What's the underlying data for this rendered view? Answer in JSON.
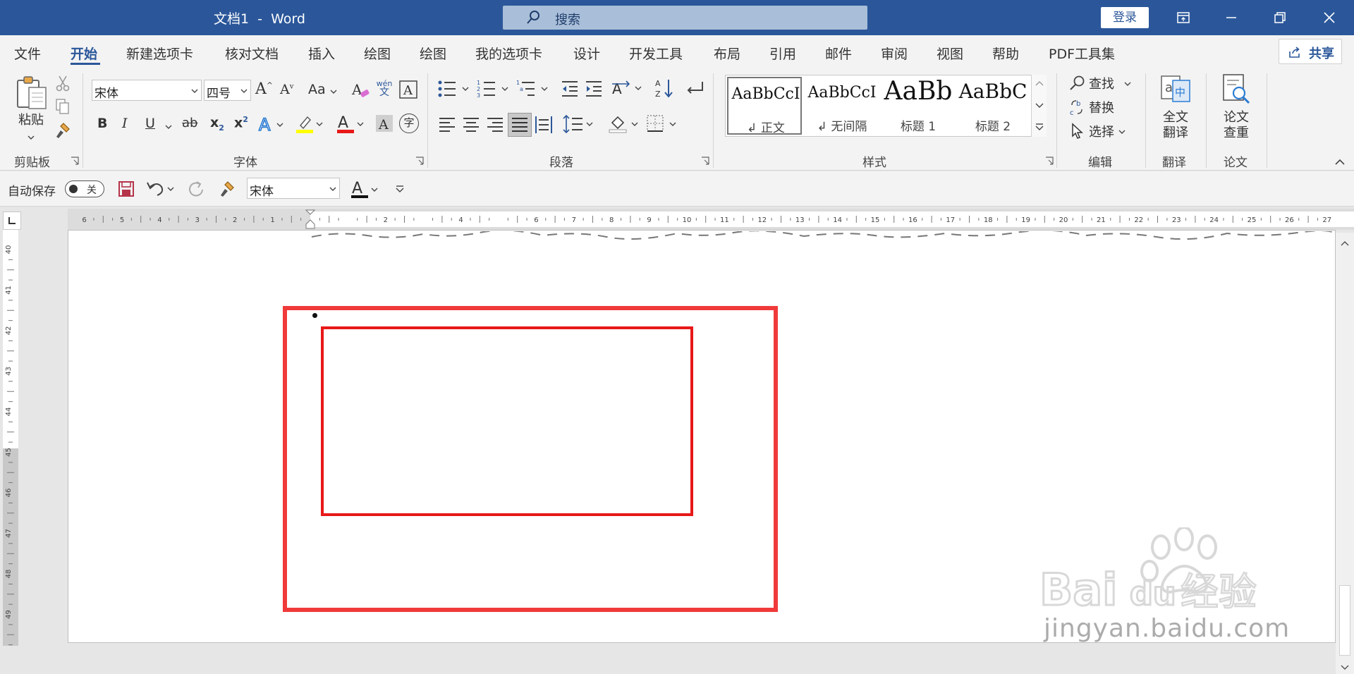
{
  "titlebar": {
    "title": "文档1  -  Word",
    "search_placeholder": "搜索",
    "login_label": "登录"
  },
  "tabs": [
    "文件",
    "开始",
    "新建选项卡",
    "核对文档",
    "插入",
    "绘图",
    "绘图",
    "我的选项卡",
    "设计",
    "开发工具",
    "布局",
    "引用",
    "邮件",
    "审阅",
    "视图",
    "帮助",
    "PDF工具集"
  ],
  "active_tab": "开始",
  "share_label": "共享",
  "ribbon": {
    "clipboard": {
      "paste_label": "粘贴",
      "group_label": "剪贴板"
    },
    "font": {
      "font_name": "宋体",
      "font_size": "四号",
      "group_label": "字体",
      "change_case": "Aa",
      "grow": "A",
      "shrink": "A",
      "phonetic_top": "wén",
      "phonetic_bottom": "文",
      "bold": "B",
      "italic": "I",
      "underline": "U",
      "strike": "ab",
      "subscript": "x",
      "superscript": "x",
      "enclose": "字"
    },
    "paragraph": {
      "group_label": "段落"
    },
    "styles": {
      "group_label": "样式",
      "items": [
        {
          "preview": "AaBbCcI",
          "name": "正文"
        },
        {
          "preview": "AaBbCcI",
          "name": "无间隔"
        },
        {
          "preview": "AaBb",
          "name": "标题 1"
        },
        {
          "preview": "AaBbC",
          "name": "标题 2"
        }
      ]
    },
    "editing": {
      "find": "查找",
      "replace": "替换",
      "select": "选择",
      "group_label": "编辑"
    },
    "translate": {
      "label_line1": "全文",
      "label_line2": "翻译",
      "group_label": "翻译"
    },
    "paper": {
      "label_line1": "论文",
      "label_line2": "查重",
      "group_label": "论文"
    }
  },
  "qat": {
    "autosave_label": "自动保存",
    "autosave_state": "关",
    "font_name": "宋体"
  },
  "ruler": {
    "left_numbers": [
      "6",
      "5",
      "4",
      "3",
      "2",
      "1"
    ],
    "right_numbers": [
      "2",
      "4",
      "6",
      "7",
      "8",
      "9",
      "10",
      "11",
      "12",
      "13",
      "14",
      "15",
      "16",
      "17",
      "18",
      "19",
      "20",
      "21",
      "22",
      "23",
      "24",
      "25",
      "26",
      "27"
    ],
    "vertical_numbers": [
      "40",
      "41",
      "42",
      "43",
      "44",
      "45",
      "46",
      "47",
      "48",
      "49"
    ]
  },
  "watermark": {
    "brand": "Bai du经验",
    "url": "jingyan.baidu.com"
  },
  "colors": {
    "brand_blue": "#2b579a",
    "box_red": "#f03a3a",
    "inner_red": "#e81818"
  }
}
